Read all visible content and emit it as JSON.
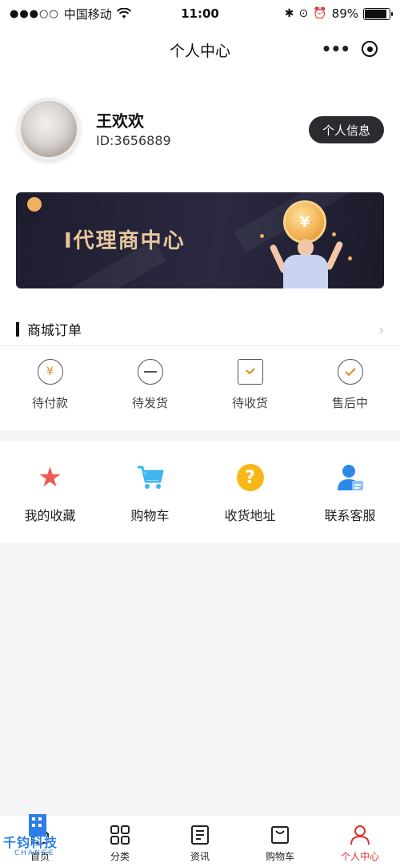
{
  "status_bar": {
    "signal": "●●●○○",
    "carrier": "中国移动",
    "time": "11:00",
    "battery_percent": "89%",
    "battery_level": 0.89
  },
  "nav": {
    "title": "个人中心",
    "more_icon": "more-dots-icon",
    "close_icon": "target-circle-icon"
  },
  "profile": {
    "name": "王欢欢",
    "id": "ID:3656889",
    "info_button": "个人信息"
  },
  "banner": {
    "title": "I代理商中心",
    "coin_symbol": "¥"
  },
  "orders": {
    "title": "商城订单",
    "items": [
      {
        "label": "待付款",
        "icon": "yen-circle-icon"
      },
      {
        "label": "待发货",
        "icon": "minus-circle-icon"
      },
      {
        "label": "待收货",
        "icon": "inbox-check-icon"
      },
      {
        "label": "售后中",
        "icon": "check-circle-icon"
      }
    ]
  },
  "features": [
    {
      "label": "我的收藏",
      "icon": "star-icon",
      "color": "#ef5a50"
    },
    {
      "label": "购物车",
      "icon": "cart-icon",
      "color": "#3fb6f0"
    },
    {
      "label": "收货地址",
      "icon": "question-icon",
      "color": "#f7b817"
    },
    {
      "label": "联系客服",
      "icon": "user-card-icon",
      "color": "#2d88e8"
    }
  ],
  "tabs": [
    {
      "label": "首页",
      "icon": "home-icon"
    },
    {
      "label": "分类",
      "icon": "grid-icon"
    },
    {
      "label": "资讯",
      "icon": "news-icon"
    },
    {
      "label": "购物车",
      "icon": "bag-icon"
    },
    {
      "label": "个人中心",
      "icon": "user-icon",
      "active": true
    }
  ],
  "watermark": {
    "text": "千钧科技",
    "sub": "CHANGE"
  },
  "colors": {
    "accent": "#e0302c",
    "banner_gold": "#e7c79e",
    "dark_button": "#2b2b30"
  }
}
